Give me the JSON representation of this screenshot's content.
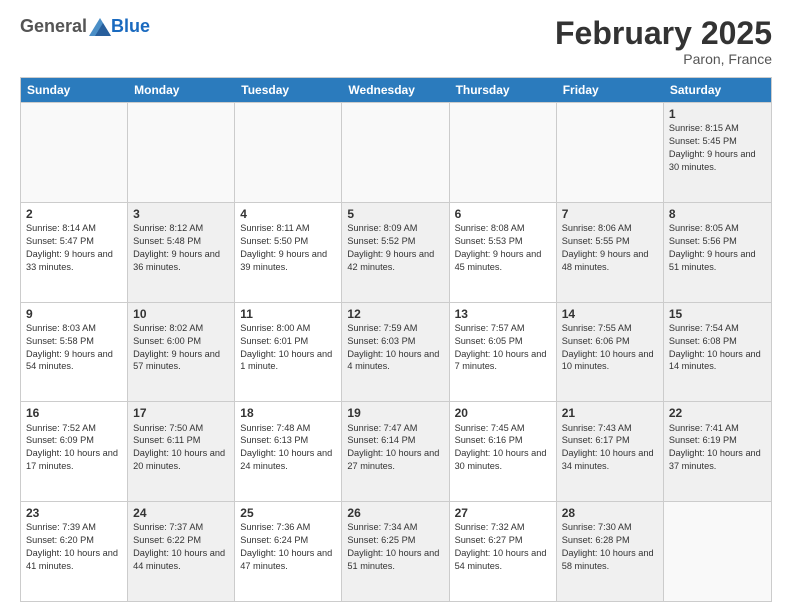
{
  "header": {
    "logo_general": "General",
    "logo_blue": "Blue",
    "month_title": "February 2025",
    "location": "Paron, France"
  },
  "weekdays": [
    "Sunday",
    "Monday",
    "Tuesday",
    "Wednesday",
    "Thursday",
    "Friday",
    "Saturday"
  ],
  "rows": [
    {
      "cells": [
        {
          "day": "",
          "text": "",
          "empty": true
        },
        {
          "day": "",
          "text": "",
          "empty": true
        },
        {
          "day": "",
          "text": "",
          "empty": true
        },
        {
          "day": "",
          "text": "",
          "empty": true
        },
        {
          "day": "",
          "text": "",
          "empty": true
        },
        {
          "day": "",
          "text": "",
          "empty": true
        },
        {
          "day": "1",
          "text": "Sunrise: 8:15 AM\nSunset: 5:45 PM\nDaylight: 9 hours and 30 minutes.",
          "shaded": true
        }
      ]
    },
    {
      "cells": [
        {
          "day": "2",
          "text": "Sunrise: 8:14 AM\nSunset: 5:47 PM\nDaylight: 9 hours and 33 minutes."
        },
        {
          "day": "3",
          "text": "Sunrise: 8:12 AM\nSunset: 5:48 PM\nDaylight: 9 hours and 36 minutes.",
          "shaded": true
        },
        {
          "day": "4",
          "text": "Sunrise: 8:11 AM\nSunset: 5:50 PM\nDaylight: 9 hours and 39 minutes."
        },
        {
          "day": "5",
          "text": "Sunrise: 8:09 AM\nSunset: 5:52 PM\nDaylight: 9 hours and 42 minutes.",
          "shaded": true
        },
        {
          "day": "6",
          "text": "Sunrise: 8:08 AM\nSunset: 5:53 PM\nDaylight: 9 hours and 45 minutes."
        },
        {
          "day": "7",
          "text": "Sunrise: 8:06 AM\nSunset: 5:55 PM\nDaylight: 9 hours and 48 minutes.",
          "shaded": true
        },
        {
          "day": "8",
          "text": "Sunrise: 8:05 AM\nSunset: 5:56 PM\nDaylight: 9 hours and 51 minutes.",
          "shaded": true
        }
      ]
    },
    {
      "cells": [
        {
          "day": "9",
          "text": "Sunrise: 8:03 AM\nSunset: 5:58 PM\nDaylight: 9 hours and 54 minutes."
        },
        {
          "day": "10",
          "text": "Sunrise: 8:02 AM\nSunset: 6:00 PM\nDaylight: 9 hours and 57 minutes.",
          "shaded": true
        },
        {
          "day": "11",
          "text": "Sunrise: 8:00 AM\nSunset: 6:01 PM\nDaylight: 10 hours and 1 minute."
        },
        {
          "day": "12",
          "text": "Sunrise: 7:59 AM\nSunset: 6:03 PM\nDaylight: 10 hours and 4 minutes.",
          "shaded": true
        },
        {
          "day": "13",
          "text": "Sunrise: 7:57 AM\nSunset: 6:05 PM\nDaylight: 10 hours and 7 minutes."
        },
        {
          "day": "14",
          "text": "Sunrise: 7:55 AM\nSunset: 6:06 PM\nDaylight: 10 hours and 10 minutes.",
          "shaded": true
        },
        {
          "day": "15",
          "text": "Sunrise: 7:54 AM\nSunset: 6:08 PM\nDaylight: 10 hours and 14 minutes.",
          "shaded": true
        }
      ]
    },
    {
      "cells": [
        {
          "day": "16",
          "text": "Sunrise: 7:52 AM\nSunset: 6:09 PM\nDaylight: 10 hours and 17 minutes."
        },
        {
          "day": "17",
          "text": "Sunrise: 7:50 AM\nSunset: 6:11 PM\nDaylight: 10 hours and 20 minutes.",
          "shaded": true
        },
        {
          "day": "18",
          "text": "Sunrise: 7:48 AM\nSunset: 6:13 PM\nDaylight: 10 hours and 24 minutes."
        },
        {
          "day": "19",
          "text": "Sunrise: 7:47 AM\nSunset: 6:14 PM\nDaylight: 10 hours and 27 minutes.",
          "shaded": true
        },
        {
          "day": "20",
          "text": "Sunrise: 7:45 AM\nSunset: 6:16 PM\nDaylight: 10 hours and 30 minutes."
        },
        {
          "day": "21",
          "text": "Sunrise: 7:43 AM\nSunset: 6:17 PM\nDaylight: 10 hours and 34 minutes.",
          "shaded": true
        },
        {
          "day": "22",
          "text": "Sunrise: 7:41 AM\nSunset: 6:19 PM\nDaylight: 10 hours and 37 minutes.",
          "shaded": true
        }
      ]
    },
    {
      "cells": [
        {
          "day": "23",
          "text": "Sunrise: 7:39 AM\nSunset: 6:20 PM\nDaylight: 10 hours and 41 minutes."
        },
        {
          "day": "24",
          "text": "Sunrise: 7:37 AM\nSunset: 6:22 PM\nDaylight: 10 hours and 44 minutes.",
          "shaded": true
        },
        {
          "day": "25",
          "text": "Sunrise: 7:36 AM\nSunset: 6:24 PM\nDaylight: 10 hours and 47 minutes."
        },
        {
          "day": "26",
          "text": "Sunrise: 7:34 AM\nSunset: 6:25 PM\nDaylight: 10 hours and 51 minutes.",
          "shaded": true
        },
        {
          "day": "27",
          "text": "Sunrise: 7:32 AM\nSunset: 6:27 PM\nDaylight: 10 hours and 54 minutes."
        },
        {
          "day": "28",
          "text": "Sunrise: 7:30 AM\nSunset: 6:28 PM\nDaylight: 10 hours and 58 minutes.",
          "shaded": true
        },
        {
          "day": "",
          "text": "",
          "empty": true
        }
      ]
    }
  ]
}
